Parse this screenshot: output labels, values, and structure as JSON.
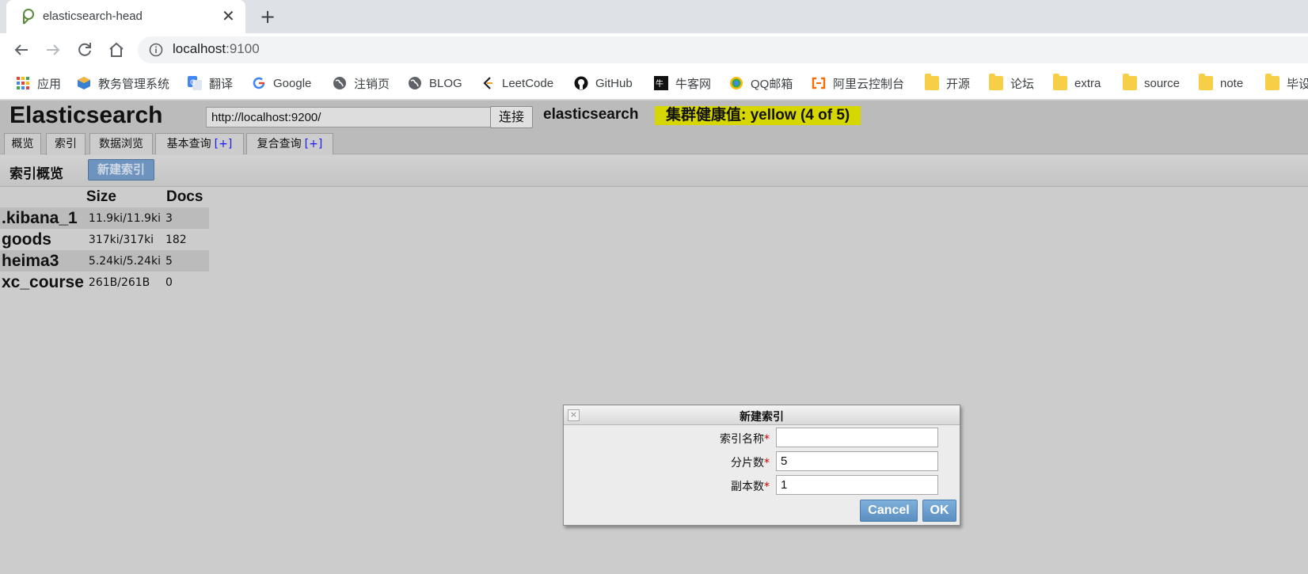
{
  "browser": {
    "tab_title": "elasticsearch-head",
    "tab_close": "✕",
    "new_tab": "+",
    "url_host": "localhost",
    "url_port": ":9100",
    "bookmarks": [
      "应用",
      "教务管理系统",
      "翻译",
      "Google",
      "注销页",
      "BLOG",
      "LeetCode",
      "GitHub",
      "牛客网",
      "QQ邮箱",
      "阿里云控制台",
      "开源",
      "论坛",
      "extra",
      "source",
      "note",
      "毕设"
    ]
  },
  "app": {
    "title": "Elasticsearch",
    "server_url": "http://localhost:9200/",
    "connect_label": "连接",
    "cluster_name": "elasticsearch",
    "health_text": "集群健康值: yellow (4 of 5)",
    "health_color": "#d7d700",
    "tabs": [
      {
        "label": "概览"
      },
      {
        "label": "索引"
      },
      {
        "label": "数据浏览"
      },
      {
        "label": "基本查询",
        "plus": "[+]"
      },
      {
        "label": "复合查询",
        "plus": "[+]"
      }
    ],
    "active_tab": "索引"
  },
  "indices": {
    "section_title": "索引概览",
    "new_index_label": "新建索引",
    "columns": [
      "Size",
      "Docs"
    ],
    "rows": [
      {
        "name": ".kibana_1",
        "size": "11.9ki/11.9ki",
        "docs": "3"
      },
      {
        "name": "goods",
        "size": "317ki/317ki",
        "docs": "182"
      },
      {
        "name": "heima3",
        "size": "5.24ki/5.24ki",
        "docs": "5"
      },
      {
        "name": "xc_course",
        "size": "261B/261B",
        "docs": "0"
      }
    ]
  },
  "dialog": {
    "title": "新建索引",
    "close_glyph": "×",
    "fields": [
      {
        "label": "索引名称",
        "required": "*",
        "value": ""
      },
      {
        "label": "分片数",
        "required": "*",
        "value": "5"
      },
      {
        "label": "副本数",
        "required": "*",
        "value": "1"
      }
    ],
    "cancel_label": "Cancel",
    "ok_label": "OK",
    "button_color": "#6a9fd0"
  }
}
